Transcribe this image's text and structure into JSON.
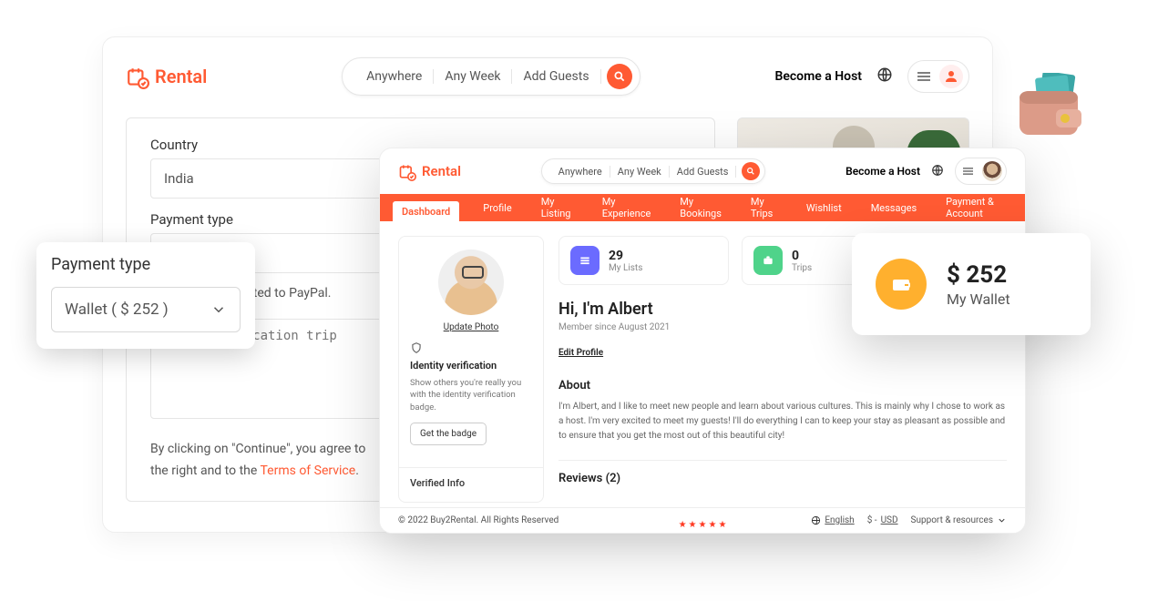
{
  "brand": "Rental",
  "search": {
    "seg1": "Anywhere",
    "seg2": "Any Week",
    "seg3": "Add Guests"
  },
  "host_link": "Become a Host",
  "back_form": {
    "country_label": "Country",
    "country_value": "India",
    "paytype_label": "Payment type",
    "paytype_value": "Wallet ( $ 252 )",
    "redirect_note": "You will be redirected to PayPal.",
    "msg_placeholder": "oking the vacation trip",
    "agree_pre": "By clicking on \"Continue\", you agree to",
    "agree_mid": "the right and to the ",
    "agree_link": "Terms of Service",
    "agree_post": "."
  },
  "pay_popover": {
    "title": "Payment type",
    "value": "Wallet ( $ 252 )"
  },
  "nav": [
    "Dashboard",
    "Profile",
    "My Listing",
    "My Experience",
    "My Bookings",
    "My Trips",
    "Wishlist",
    "Messages",
    "Payment & Account"
  ],
  "profile_card": {
    "update_photo": "Update Photo",
    "idver_h": "Identity verification",
    "idver_txt": "Show others you're really you with the identity verification badge.",
    "badge_btn": "Get the badge",
    "verified": "Verified Info"
  },
  "stats": {
    "lists_num": "29",
    "lists_lbl": "My Lists",
    "trips_num": "0",
    "trips_lbl": "Trips"
  },
  "main": {
    "greet": "Hi, I'm Albert",
    "member": "Member since August 2021",
    "edit": "Edit Profile",
    "about_h": "About",
    "about_p": "I'm Albert, and I like to meet new people and learn about various cultures. This is mainly why I chose to work as a host. I'm very excited to meet my guests! I'll do everything I can to keep your stay as pleasant as possible and to ensure that you get the most out of this beautiful city!",
    "reviews_h": "Reviews (2)"
  },
  "footer": {
    "copyright": "© 2022 Buy2Rental. All Rights Reserved",
    "lang": "English",
    "cur_prefix": "$ - ",
    "cur": "USD",
    "support": "Support & resources"
  },
  "wallet": {
    "amount": "$  252",
    "label": "My Wallet"
  }
}
